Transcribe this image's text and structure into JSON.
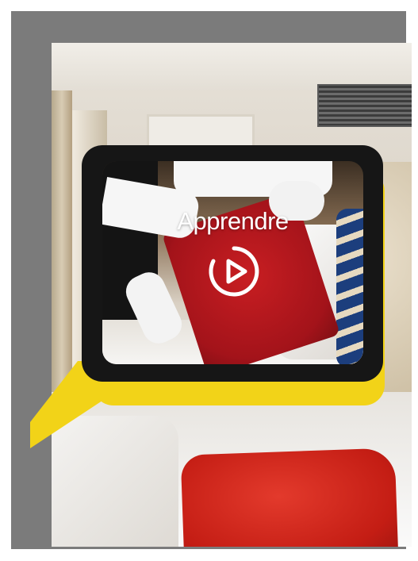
{
  "card": {
    "title": "Apprendre",
    "play_icon": "play-circle-icon",
    "accent_color": "#f2d318",
    "card_color": "#161616"
  },
  "background": {
    "pillow_color": "#d32a20"
  }
}
